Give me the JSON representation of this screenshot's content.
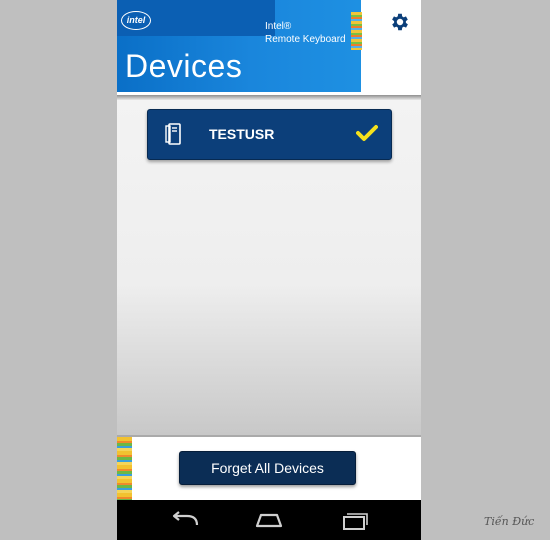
{
  "header": {
    "logo_text": "intel",
    "product_line1": "Intel®",
    "product_line2": "Remote Keyboard",
    "title": "Devices",
    "settings_icon": "gear-icon"
  },
  "devices": [
    {
      "name": "TESTUSR",
      "icon": "computer-icon",
      "selected": true,
      "status_icon": "checkmark-icon"
    }
  ],
  "footer": {
    "forget_label": "Forget All Devices"
  },
  "navbar": {
    "items": [
      "back-icon",
      "home-icon",
      "recent-apps-icon"
    ]
  },
  "watermark": "Tiến Đức",
  "colors": {
    "banner_blue": "#1a86dc",
    "card_navy": "#0c3f7a",
    "button_navy": "#0b2d55",
    "check_yellow": "#f5e11c"
  }
}
